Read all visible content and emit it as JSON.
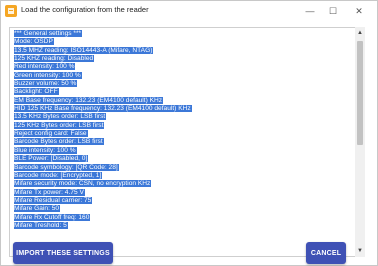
{
  "window": {
    "title": "Load the configuration from the reader",
    "minimize_glyph": "—",
    "maximize_glyph": "☐",
    "close_glyph": "✕"
  },
  "settings_text": {
    "lines": [
      "*** General settings ***",
      "Mode: OSDP",
      "13.5 MHZ reading: ISO14443-A (Mifare, NTAG)",
      "125 KHZ reading: Disabled",
      "Red intensity: 100 %",
      "Green intensity: 100 %",
      "Buzzer volume: 50 %",
      "Backlight: OFF",
      "EM Base frequency: 132.23 (EM4100 default) KHz",
      "HID 125 KHz Base frequency: 132.23 (EM4100 default) KHz",
      "13.5 KHz Bytes order: LSB first",
      "125 KHz Bytes order: LSB first",
      "Reject config card: False",
      "Barcode Bytes order: LSB first",
      "Blue intensity: 100 %",
      "BLE Power: [Disabled, 0]",
      "Barcode symbology: [QR Code: 28]",
      "Barcode mode: [Encrypted, 1]",
      "Mifare security mode: CSN, no encryption KHz",
      "Mifare Tx power: 4.75 V",
      "Mifare Residual carrier: 75",
      "Mifare Gain: 50",
      "Mifare Rx Cutoff freq: 160",
      "Mifare Treshold: 5"
    ]
  },
  "scrollbar": {
    "up_glyph": "▲",
    "down_glyph": "▼"
  },
  "buttons": {
    "import_label": "IMPORT THESE SETTINGS",
    "cancel_label": "CANCEL"
  },
  "colors": {
    "selection": "#3c78d8",
    "button": "#3f51b5",
    "app_icon": "#f5a623"
  },
  "icons": {
    "app": "app-icon",
    "minimize": "minimize-icon",
    "maximize": "maximize-icon",
    "close": "close-icon"
  }
}
